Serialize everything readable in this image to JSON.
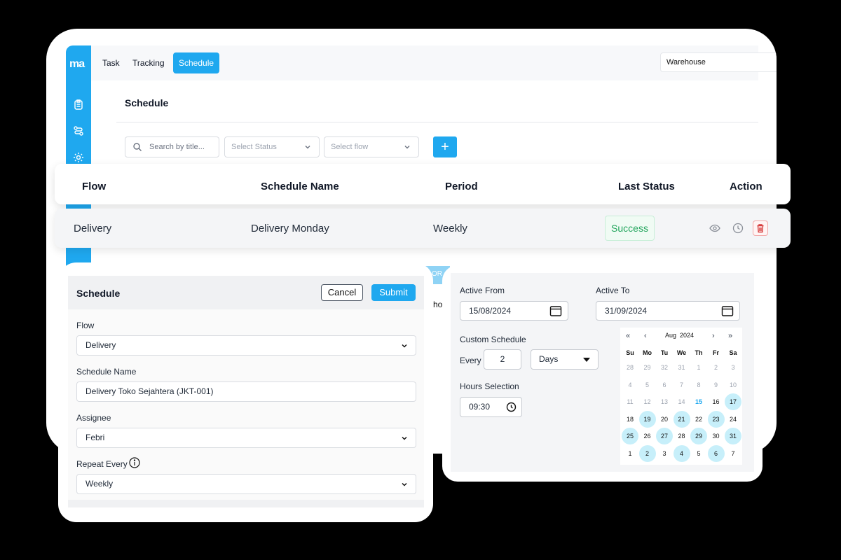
{
  "app": {
    "logo": "ma"
  },
  "topbar": {
    "tabs": [
      {
        "label": "Task",
        "active": false
      },
      {
        "label": "Tracking",
        "active": false
      },
      {
        "label": "Schedule",
        "active": true
      }
    ],
    "warehouse_select": "Warehouse"
  },
  "page": {
    "title": "Schedule",
    "search_placeholder": "Search by title...",
    "status_placeholder": "Select Status",
    "flow_placeholder": "Select flow",
    "add_label": "+"
  },
  "table": {
    "headers": [
      "Flow",
      "Schedule Name",
      "Period",
      "Last Status",
      "Action"
    ],
    "rows": [
      {
        "flow": "Delivery",
        "schedule_name": "Delivery Monday",
        "period": "Weekly",
        "last_status": "Success"
      }
    ]
  },
  "form": {
    "title": "Schedule",
    "cancel": "Cancel",
    "submit": "Submit",
    "flow_label": "Flow",
    "flow_value": "Delivery",
    "name_label": "Schedule Name",
    "name_value": "Delivery Toko Sejahtera (JKT-001)",
    "assignee_label": "Assignee",
    "assignee_value": "Febri",
    "repeat_label": "Repeat Every",
    "repeat_value": "Weekly"
  },
  "schedule_panel": {
    "active_from_label": "Active From",
    "active_from": "15/08/2024",
    "active_to_label": "Active To",
    "active_to": "31/09/2024",
    "custom_label": "Custom Schedule",
    "every_label": "Every",
    "every_value": "2",
    "unit": "Days",
    "hours_label": "Hours Selection",
    "time": "09:30"
  },
  "calendar": {
    "month": "Aug",
    "year": "2024",
    "weekdays": [
      "Su",
      "Mo",
      "Tu",
      "We",
      "Th",
      "Fr",
      "Sa"
    ],
    "weeks": [
      [
        "28",
        "29",
        "32",
        "31",
        "1",
        "2",
        "3"
      ],
      [
        "4",
        "5",
        "6",
        "7",
        "8",
        "9",
        "10"
      ],
      [
        "11",
        "12",
        "13",
        "14",
        "15",
        "16",
        "17"
      ],
      [
        "18",
        "19",
        "20",
        "21",
        "22",
        "23",
        "24"
      ],
      [
        "25",
        "26",
        "27",
        "28",
        "29",
        "30",
        "31"
      ],
      [
        "1",
        "2",
        "3",
        "4",
        "5",
        "6",
        "7"
      ]
    ]
  },
  "fragments": {
    "chip": "OR",
    "text": "ho"
  },
  "colors": {
    "accent": "#1fa8ef",
    "success": "#22a55c",
    "danger": "#e05252",
    "highlight": "#c7effa"
  }
}
